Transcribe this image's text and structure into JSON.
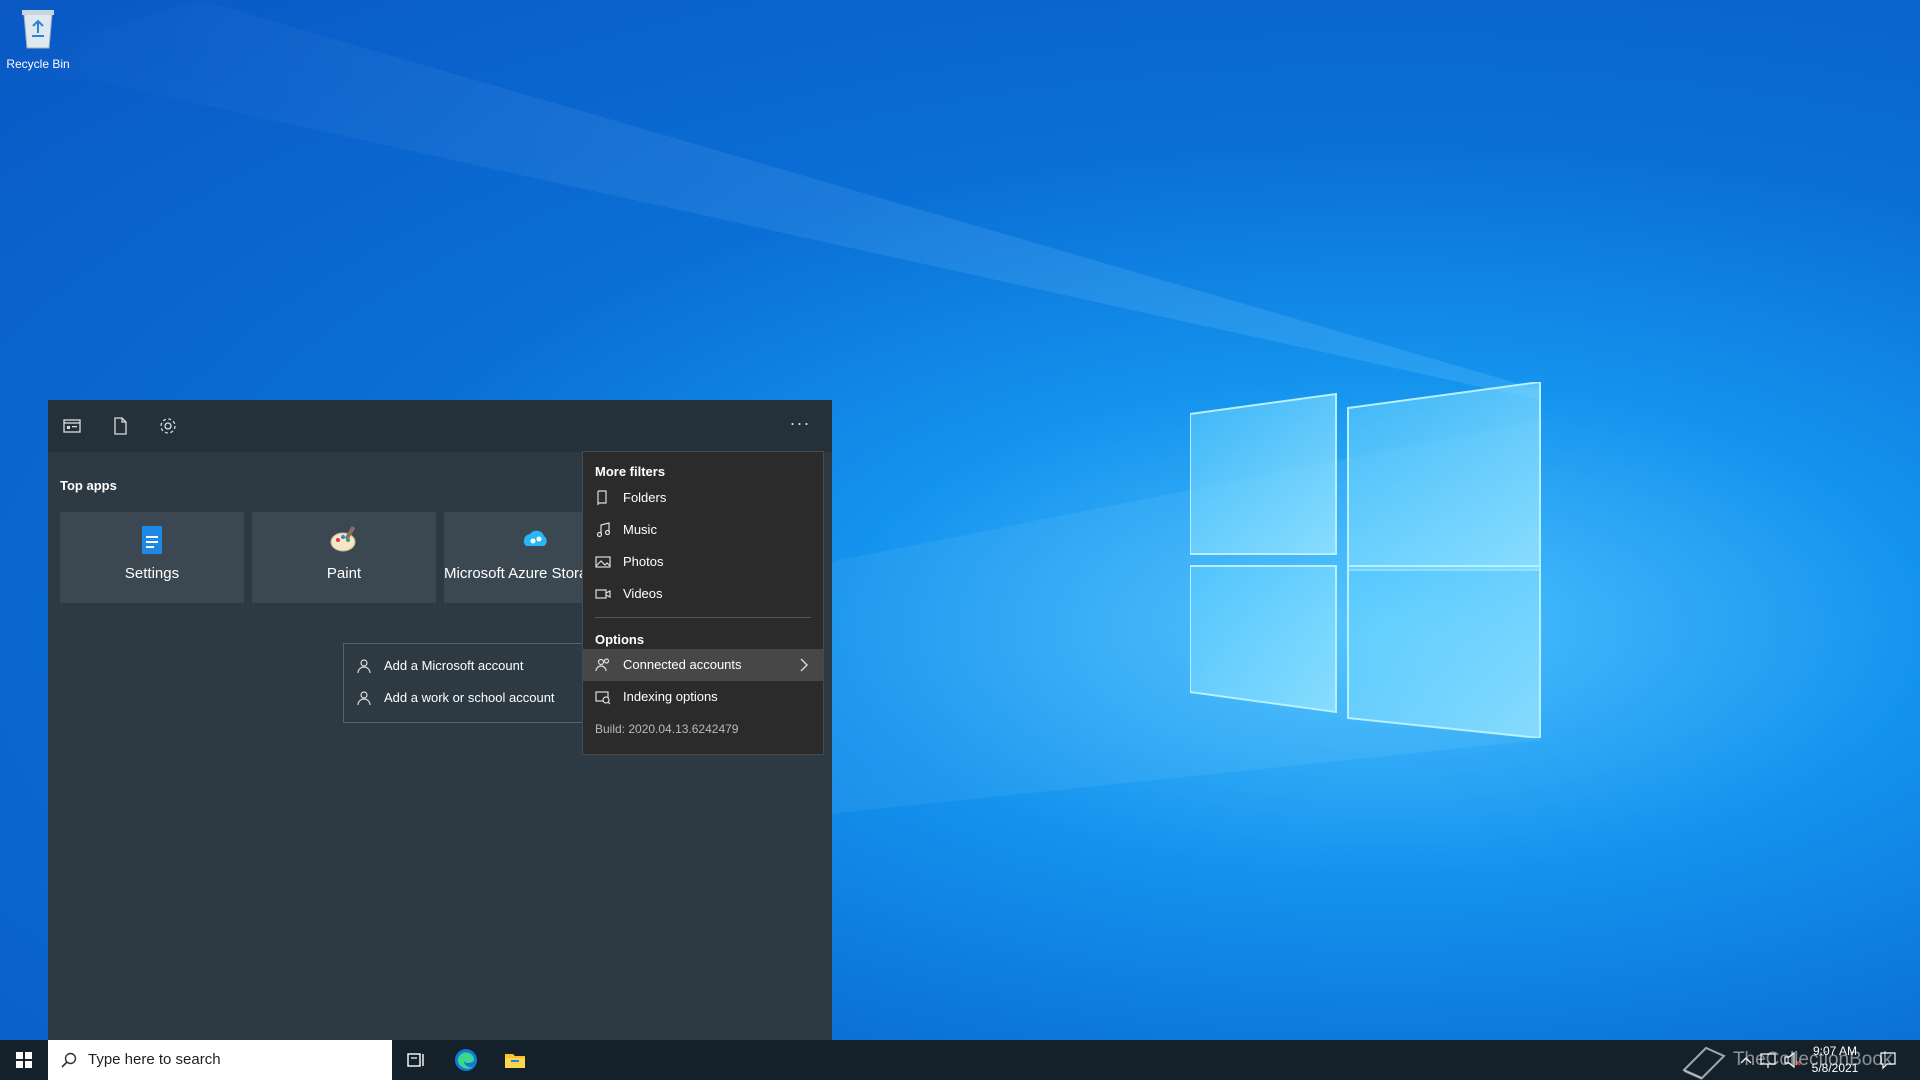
{
  "desktop": {
    "recycle_bin_label": "Recycle Bin"
  },
  "search_panel": {
    "toolbar": {
      "apps_icon": "apps-filter-icon",
      "documents_icon": "document-icon",
      "settings_icon": "gear-icon",
      "more_label": "···"
    },
    "section_title": "Top apps",
    "top_apps": [
      {
        "label": "Settings",
        "icon": "settings-app-icon"
      },
      {
        "label": "Paint",
        "icon": "paint-app-icon"
      },
      {
        "label": "Microsoft Azure Storage Explorer",
        "icon": "azure-app-icon"
      }
    ]
  },
  "account_submenu": {
    "items": [
      {
        "label": "Add a Microsoft account",
        "icon": "person-icon"
      },
      {
        "label": "Add a work or school account",
        "icon": "person-icon"
      }
    ]
  },
  "context_menu": {
    "filters_header": "More filters",
    "filters": [
      {
        "label": "Folders",
        "icon": "folder-icon"
      },
      {
        "label": "Music",
        "icon": "music-icon"
      },
      {
        "label": "Photos",
        "icon": "photo-icon"
      },
      {
        "label": "Videos",
        "icon": "video-icon"
      }
    ],
    "options_header": "Options",
    "options": [
      {
        "label": "Connected accounts",
        "icon": "people-icon",
        "highlighted": true
      },
      {
        "label": "Indexing options",
        "icon": "indexing-icon"
      }
    ],
    "build": "Build: 2020.04.13.6242479"
  },
  "taskbar": {
    "search_placeholder": "Type here to search",
    "clock_time": "9:07 AM",
    "clock_date": "5/8/2021"
  },
  "watermark": "TheCollectionBook",
  "colors": {
    "accent": "#0a6fd6",
    "panel": "#2d3a44",
    "menu": "#2b2b2b",
    "taskbar": "#15212a"
  }
}
